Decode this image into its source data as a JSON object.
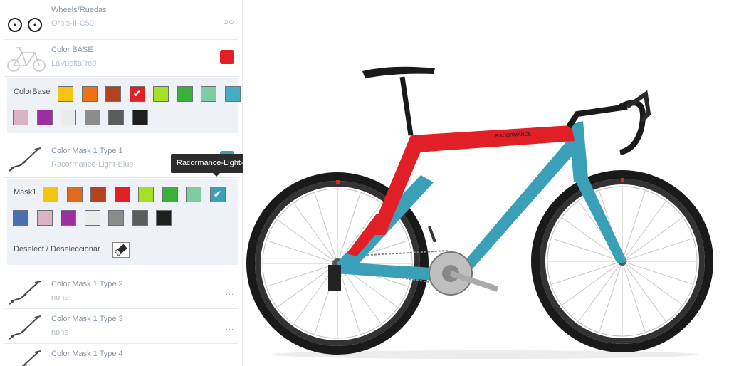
{
  "rows": {
    "wheels": {
      "title": "Wheels/Ruedas",
      "value": "Orbis-II-C50",
      "indicator": "○○"
    },
    "color_base": {
      "title": "Color BASE",
      "value": "LaVueltaRed",
      "swatch_color": "#e01f26"
    },
    "mask1": {
      "title": "Color Mask 1 Type 1",
      "value": "Racormance-Light-Blue",
      "swatch_color": "#3aa0b8"
    },
    "mask2": {
      "title": "Color Mask 1 Type 2",
      "value": "none",
      "more": "..."
    },
    "mask3": {
      "title": "Color Mask 1 Type 3",
      "value": "none",
      "more": "..."
    },
    "mask4": {
      "title": "Color Mask 1 Type 4",
      "value": "",
      "more": ""
    }
  },
  "colorbase_picker": {
    "label": "ColorBase",
    "swatches": [
      {
        "color": "#f5c412"
      },
      {
        "color": "#f07016"
      },
      {
        "color": "#b3421a"
      },
      {
        "color": "#e01f26",
        "selected": true
      },
      {
        "color": "#a6e025"
      },
      {
        "color": "#3ab23a"
      },
      {
        "color": "#7fcca0"
      },
      {
        "color": "#44adc5"
      },
      {
        "color": "#4b6fb2"
      },
      {
        "color": "#dbb3c3"
      },
      {
        "color": "#9a2fa3"
      },
      {
        "color": "#ececec"
      },
      {
        "color": "#8c8c8c"
      },
      {
        "color": "#5c5c5c"
      },
      {
        "color": "#1e1e1e"
      }
    ]
  },
  "mask1_picker": {
    "label": "Mask1",
    "swatches": [
      {
        "color": "#f5c412"
      },
      {
        "color": "#e06a1e"
      },
      {
        "color": "#b3421a"
      },
      {
        "color": "#e01f26"
      },
      {
        "color": "#a6e025"
      },
      {
        "color": "#3ab23a"
      },
      {
        "color": "#7fcca0"
      },
      {
        "color": "#3aa0b8",
        "selected": true
      },
      {
        "color": "#4b6fb2"
      },
      {
        "color": "#dbb3c3"
      },
      {
        "color": "#9a2fa3"
      },
      {
        "color": "#ececec"
      },
      {
        "color": "#8c8c8c"
      },
      {
        "color": "#5c5c5c"
      },
      {
        "color": "#1e1e1e"
      }
    ]
  },
  "deselect": {
    "label": "Deselect / Deseleccionar"
  },
  "tooltip": {
    "text": "Racormance-Light-Blue"
  },
  "bike": {
    "frame_color": "#e01f26",
    "mask_color": "#3aa0b8",
    "downtube_text": "RACORMANCE"
  }
}
